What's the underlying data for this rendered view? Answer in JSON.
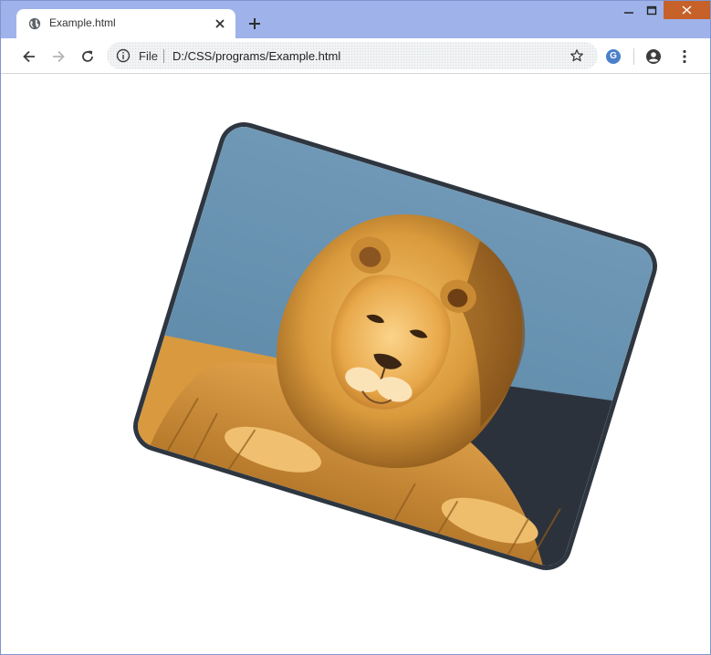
{
  "browser": {
    "tab": {
      "title": "Example.html",
      "favicon": "globe-icon"
    },
    "window_controls": [
      "minimize-icon",
      "maximize-icon",
      "close-icon"
    ],
    "toolbar": {
      "back_icon": "arrow-left-icon",
      "forward_icon": "arrow-right-icon",
      "reload_icon": "reload-icon",
      "omnibox": {
        "info_icon": "info-icon",
        "scheme_label": "File",
        "url": "D:/CSS/programs/Example.html",
        "bookmark_icon": "star-icon"
      },
      "extension_letter": "G",
      "profile_icon": "account-circle-icon",
      "menu_icon": "more-vert-icon"
    },
    "colors": {
      "tabstrip": "#9fb3ea",
      "close_button": "#c6612a",
      "image_border": "#2e3640",
      "sky": "#5f8ba8"
    }
  },
  "page": {
    "image": {
      "subject": "lion-photo",
      "rotation_deg": 17,
      "rounded_corners": true
    }
  }
}
